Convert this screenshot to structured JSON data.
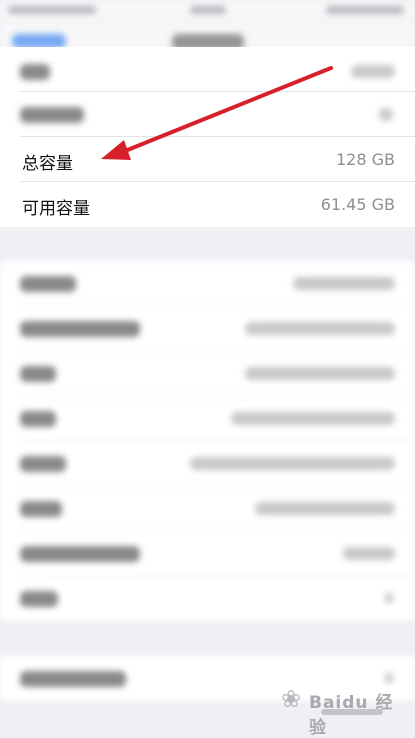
{
  "about": {
    "total_capacity": {
      "label": "总容量",
      "value": "128 GB"
    },
    "available_capacity": {
      "label": "可用容量",
      "value": "61.45 GB"
    }
  },
  "watermark": {
    "text": "Baidu 经验"
  },
  "colors": {
    "accent": "#007aff",
    "arrow": "#d8202a",
    "background": "#efeff4"
  }
}
